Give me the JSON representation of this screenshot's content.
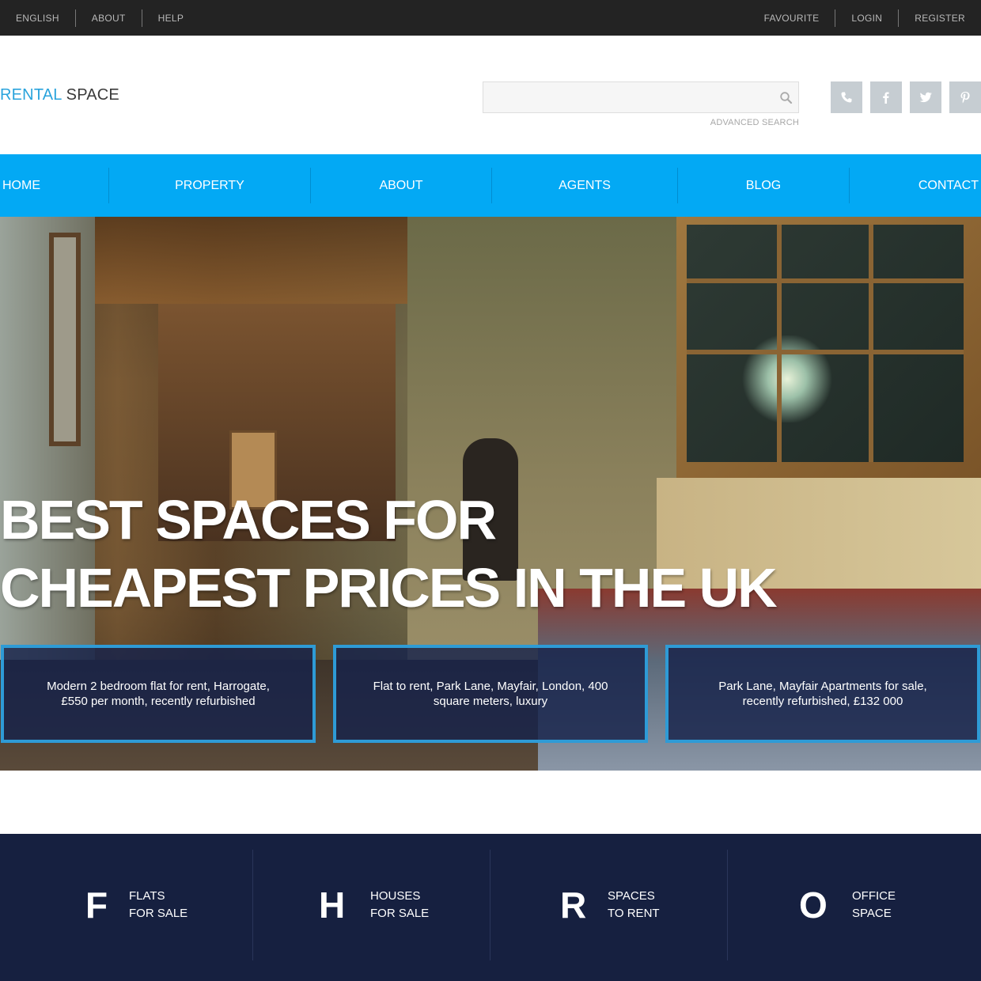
{
  "topbar": {
    "left": [
      "ENGLISH",
      "ABOUT",
      "HELP"
    ],
    "right": [
      "FAVOURITE",
      "LOGIN",
      "REGISTER"
    ]
  },
  "logo": {
    "part1": "RENTAL",
    "part2": "SPACE"
  },
  "search": {
    "placeholder": "",
    "value": "",
    "advanced": "ADVANCED SEARCH"
  },
  "social": [
    "phone-icon",
    "facebook-icon",
    "twitter-icon",
    "pinterest-icon"
  ],
  "nav": [
    "HOME",
    "PROPERTY",
    "ABOUT",
    "AGENTS",
    "BLOG",
    "CONTACT"
  ],
  "hero": {
    "line1": "BEST SPACES FOR",
    "line2": "CHEAPEST PRICES IN THE UK",
    "cards": [
      "Modern 2 bedroom flat for rent, Harrogate, £550 per month, recently refurbished",
      "Flat to rent, Park Lane, Mayfair, London, 400 square meters, luxury",
      "Park Lane, Mayfair Apartments for sale, recently refurbished, £132 000"
    ]
  },
  "categories": [
    {
      "letter": "F",
      "line1": "FLATS",
      "line2": "FOR SALE"
    },
    {
      "letter": "H",
      "line1": "HOUSES",
      "line2": "FOR SALE"
    },
    {
      "letter": "R",
      "line1": "SPACES",
      "line2": "TO RENT"
    },
    {
      "letter": "O",
      "line1": "OFFICE",
      "line2": "SPACE"
    }
  ],
  "colors": {
    "topbar": "#232323",
    "accent_blue": "#03a9f4",
    "logo_blue": "#29a3dc",
    "card_border": "#2e9bd6",
    "dark_navy": "#162040",
    "social_grey": "#c6cdd2"
  }
}
